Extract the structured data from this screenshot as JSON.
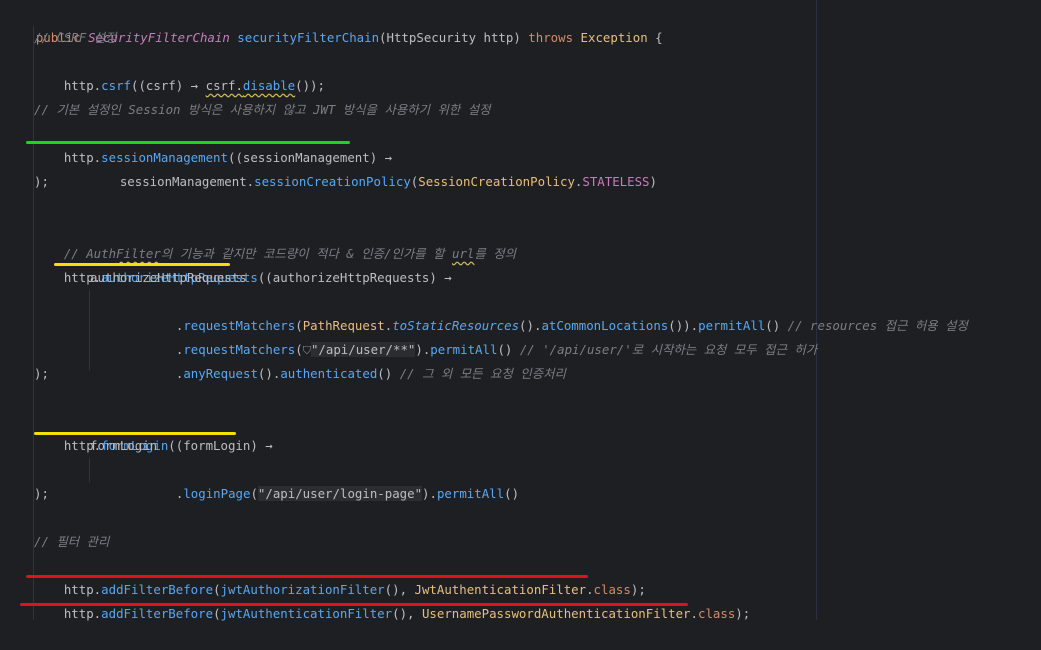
{
  "code": {
    "l1": {
      "kw_public": "public",
      "type_chain": "SecurityFilterChain",
      "method": "securityFilterChain",
      "open": "(",
      "param_type": "HttpSecurity",
      "param": "http",
      ") throws": ")",
      "throws": "throws",
      "exc": "Exception",
      "brace": "{"
    },
    "l2": "// CSRF 설정",
    "l3": {
      "a": "http.",
      "fn": "csrf",
      "b": "((csrf) → ",
      "c": "csrf.",
      "fn2": "disable",
      "d": "());"
    },
    "l5": "// 기본 설정인 Session 방식은 사용하지 않고 JWT 방식을 사용하기 위한 설정",
    "l6": {
      "a": "http.",
      "fn": "sessionManagement",
      "b": "((sessionManagement) →"
    },
    "l7": {
      "a": "sessionManagement.",
      "fn": "sessionCreationPolicy",
      "b": "(",
      "cls": "SessionCreationPolicy",
      "dot": ".",
      "fld": "STATELESS",
      "c": ")"
    },
    "l8": ");",
    "l10": {
      "a": "// Auth",
      "b": "Filter",
      "c": "의 기능과 같지만 코드량이 적다 & 인증/인가를 할 ",
      "d": "url",
      "e": "를 정의"
    },
    "l11": {
      "a": "http.",
      "fn": "authorizeHttpRequests",
      "b": "((authorizeHttpRequests) →"
    },
    "l12": "authorizeHttpRequests",
    "l13": {
      "a": ".",
      "fn": "requestMatchers",
      "b": "(",
      "cls": "PathRequest",
      "dot": ".",
      "sfn": "toStaticResources",
      "c": "().",
      "fn2": "atCommonLocations",
      "d": "()).",
      "fn3": "permitAll",
      "e": "() ",
      "cm": "// resources 접근 허용 설정"
    },
    "l14": {
      "a": ".",
      "fn": "requestMatchers",
      "b": "(",
      "shield": "⛉",
      "str": "\"/api/user/**\"",
      "c": ").",
      "fn2": "permitAll",
      "d": "() ",
      "cm": "// '/api/user/'로 시작하는 요청 모두 접근 허가"
    },
    "l15": {
      "a": ".",
      "fn": "anyRequest",
      "b": "().",
      "fn2": "authenticated",
      "c": "() ",
      "cm": "// 그 외 모든 요청 인증처리"
    },
    "l16": ");",
    "l18": {
      "a": "http.",
      "fn": "formLogin",
      "b": "((formLogin) →"
    },
    "l19": "formLogin",
    "l20": {
      "a": ".",
      "fn": "loginPage",
      "b": "(",
      "str": "\"/api/user/login-page\"",
      "c": ").",
      "fn2": "permitAll",
      "d": "()"
    },
    "l21": ");",
    "l23": "// 필터 관리",
    "l24": {
      "a": "http.",
      "fn": "addFilterBefore",
      "b": "(",
      "fn2": "jwtAuthorizationFilter",
      "c": "(), ",
      "cls": "JwtAuthenticationFilter",
      "d": ".",
      "kw": "class",
      "e": ");"
    },
    "l25": {
      "a": "http.",
      "fn": "addFilterBefore",
      "b": "(",
      "fn2": "jwtAuthenticationFilter",
      "c": "(), ",
      "cls": "UsernamePasswordAuthenticationFilter",
      "d": ".",
      "kw": "class",
      "e": ");"
    }
  },
  "colors": {
    "green_underline": "#1fd21f",
    "yellow_underline": "#f5e000",
    "red_underline": "#e0121b",
    "background": "#1e1f22"
  }
}
